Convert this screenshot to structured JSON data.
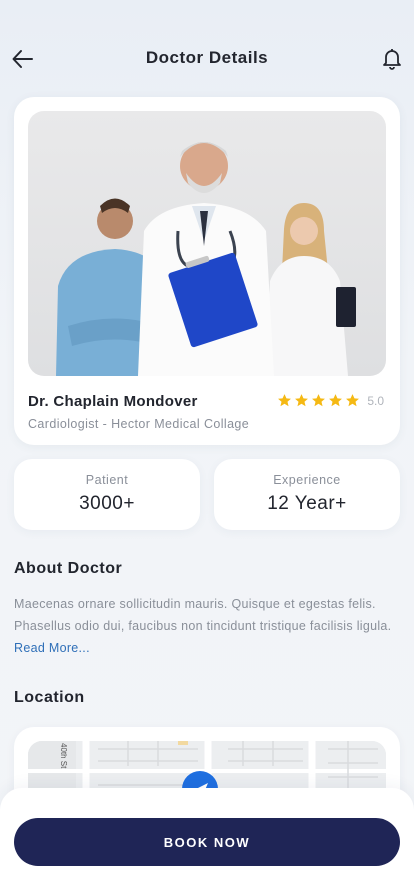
{
  "header": {
    "title": "Doctor Details",
    "back_icon": "arrow-left-icon",
    "bell_icon": "bell-icon"
  },
  "doctor": {
    "name": "Dr. Chaplain Mondover",
    "subtitle": "Cardiologist - Hector Medical Collage",
    "rating": "5.0",
    "stars_filled": 5,
    "star_color": "#f5b914"
  },
  "stats": [
    {
      "label": "Patient",
      "value": "3000+"
    },
    {
      "label": "Experience",
      "value": "12 Year+"
    }
  ],
  "about": {
    "title": "About Doctor",
    "text": "Maecenas ornare sollicitudin mauris. Quisque et egestas felis. Phasellus odio dui, faucibus non tincidunt  tristique facilisis ligula. ",
    "read_more": "Read More..."
  },
  "location": {
    "title": "Location",
    "street_label": "40th St"
  },
  "book": {
    "label": "BOOK NOW",
    "color": "#1f2556"
  }
}
